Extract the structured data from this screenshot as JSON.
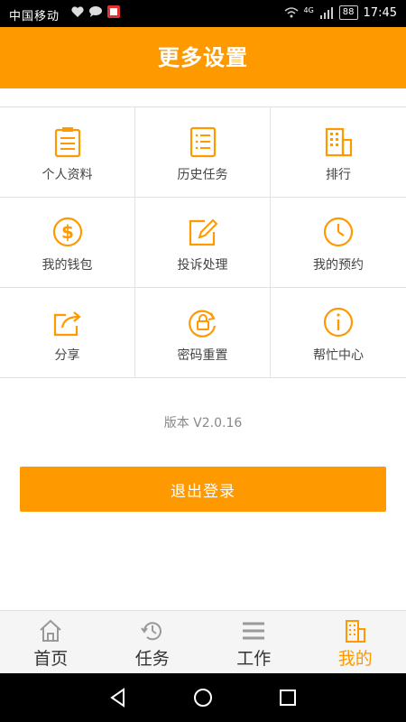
{
  "status_bar": {
    "carrier": "中国移动",
    "network": "4G",
    "battery": "88",
    "time": "17:45"
  },
  "header": {
    "title": "更多设置"
  },
  "menu": [
    {
      "label": "个人资料",
      "icon": "clipboard-icon"
    },
    {
      "label": "历史任务",
      "icon": "list-document-icon"
    },
    {
      "label": "排行",
      "icon": "building-icon"
    },
    {
      "label": "我的钱包",
      "icon": "dollar-coin-icon"
    },
    {
      "label": "投诉处理",
      "icon": "edit-pencil-icon"
    },
    {
      "label": "我的预约",
      "icon": "clock-icon"
    },
    {
      "label": "分享",
      "icon": "share-icon"
    },
    {
      "label": "密码重置",
      "icon": "lock-reset-icon"
    },
    {
      "label": "帮忙中心",
      "icon": "info-icon"
    }
  ],
  "version": "版本 V2.0.16",
  "logout_label": "退出登录",
  "tabbar": [
    {
      "label": "首页",
      "icon": "home-icon",
      "active": false
    },
    {
      "label": "任务",
      "icon": "history-icon",
      "active": false
    },
    {
      "label": "工作",
      "icon": "menu-lines-icon",
      "active": false
    },
    {
      "label": "我的",
      "icon": "building-icon",
      "active": true
    }
  ],
  "colors": {
    "accent": "#ff9900",
    "text": "#444444",
    "muted": "#888888"
  }
}
